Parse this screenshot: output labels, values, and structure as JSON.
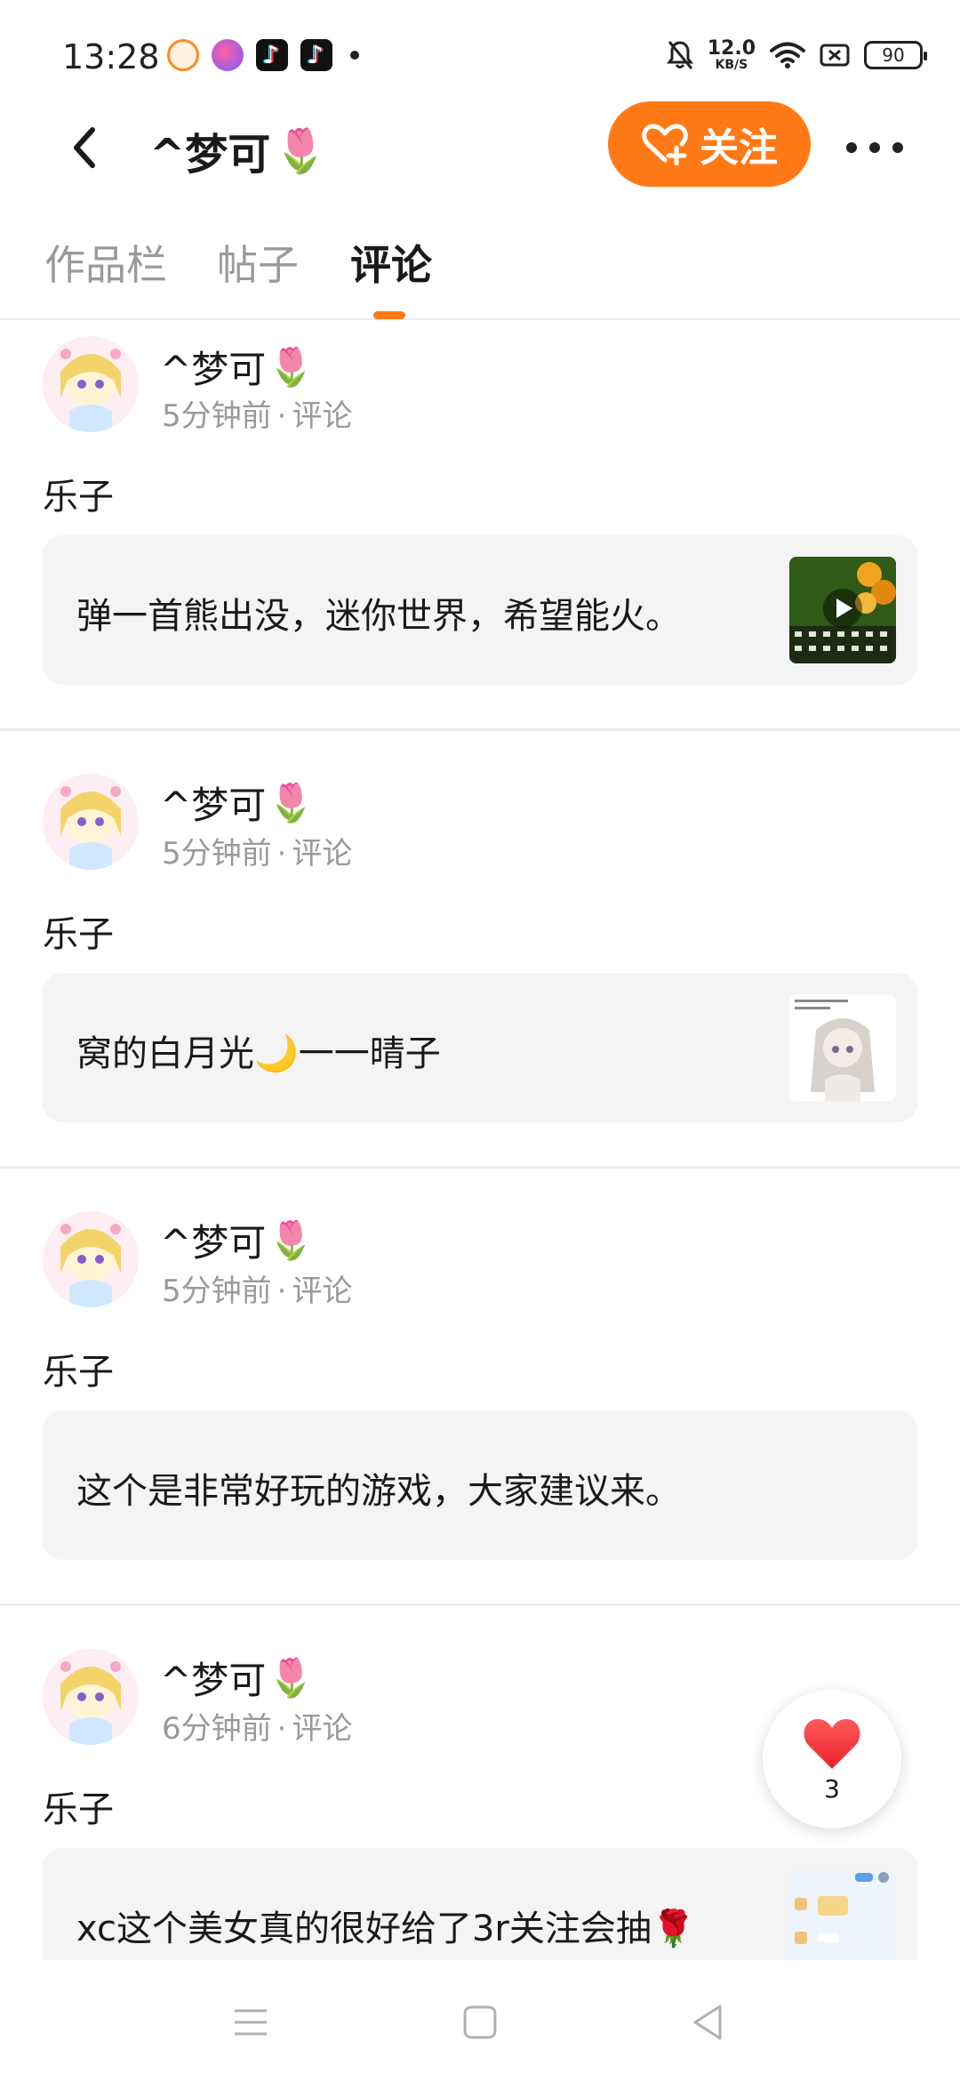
{
  "status_bar": {
    "time": "13:28",
    "net_speed_value": "12.0",
    "net_speed_unit": "KB/S",
    "battery": "90"
  },
  "header": {
    "title": "^梦可",
    "title_emoji": "🌷",
    "follow_label": "关注"
  },
  "tabs": [
    {
      "label": "作品栏",
      "active": false
    },
    {
      "label": "帖子",
      "active": false
    },
    {
      "label": "评论",
      "active": true
    }
  ],
  "posts": [
    {
      "user": "^梦可",
      "user_emoji": "🌷",
      "time": "5分钟前",
      "type": "评论",
      "comment": "乐子",
      "quote": "弹一首熊出没，迷你世界，希望能火。",
      "thumb": "video"
    },
    {
      "user": "^梦可",
      "user_emoji": "🌷",
      "time": "5分钟前",
      "type": "评论",
      "comment": "乐子",
      "quote": "窝的白月光🌙一一晴子",
      "thumb": "image"
    },
    {
      "user": "^梦可",
      "user_emoji": "🌷",
      "time": "5分钟前",
      "type": "评论",
      "comment": "乐子",
      "quote": "这个是非常好玩的游戏，大家建议来。",
      "thumb": "none"
    },
    {
      "user": "^梦可",
      "user_emoji": "🌷",
      "time": "6分钟前",
      "type": "评论",
      "comment": "乐子",
      "quote": "xc这个美女真的很好给了3r关注会抽🌹",
      "thumb": "image"
    }
  ],
  "like_fab": {
    "count": "3"
  },
  "colors": {
    "accent": "#ff7a17",
    "card_bg": "#f4f4f4",
    "meta_text": "#9a9a9a"
  },
  "icons": [
    "back-arrow-icon",
    "heart-plus-icon",
    "more-dots-icon",
    "heart-icon",
    "menu-icon",
    "home-square-icon",
    "back-triangle-icon"
  ]
}
